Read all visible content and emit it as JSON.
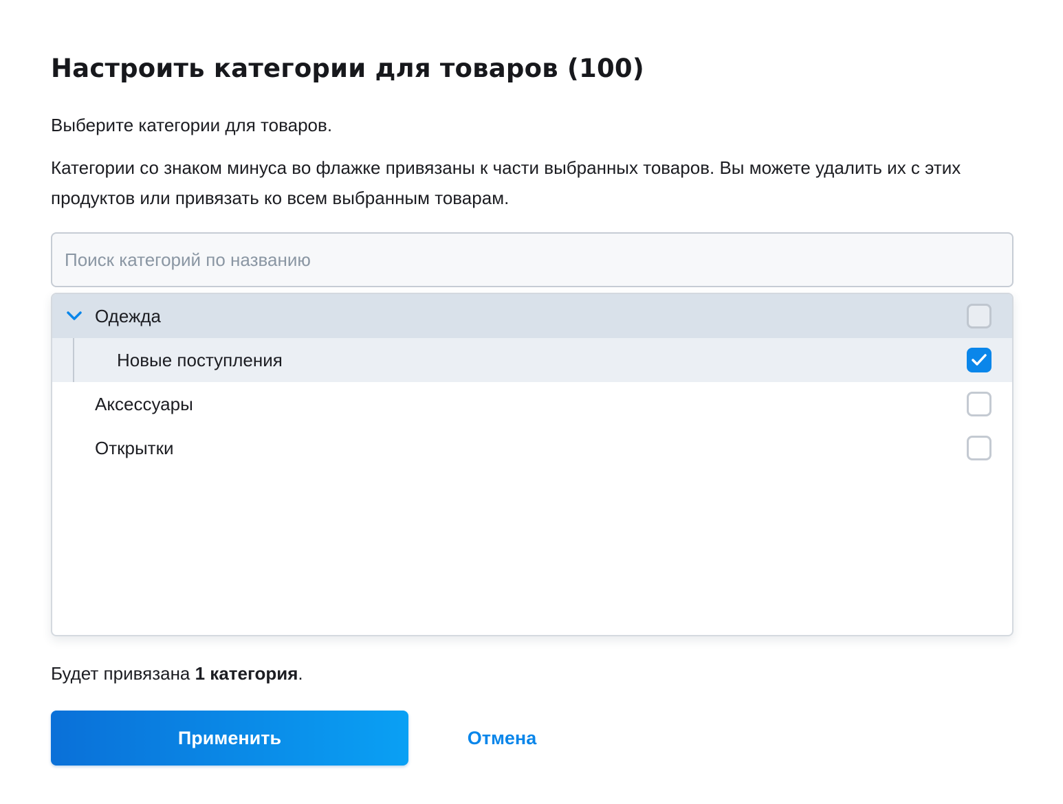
{
  "dialog": {
    "title": "Настроить категории для товаров (100)",
    "description_1": "Выберите категории для товаров.",
    "description_2": "Категории со знаком минуса во флажке привязаны к части выбранных товаров. Вы можете удалить их с этих продуктов или привязать ко всем выбранным товарам."
  },
  "search": {
    "placeholder": "Поиск категорий по названию",
    "value": ""
  },
  "tree": {
    "items": [
      {
        "label": "Одежда",
        "icon": "chevron-down-icon",
        "expanded": true,
        "checked": false
      },
      {
        "label": "Новые поступления",
        "parent": "Одежда",
        "checked": true,
        "icon": "checkmark-icon"
      },
      {
        "label": "Аксессуары",
        "checked": false
      },
      {
        "label": "Открытки",
        "checked": false
      }
    ]
  },
  "summary": {
    "prefix": "Будет привязана ",
    "bold": "1 категория",
    "suffix": "."
  },
  "actions": {
    "apply_label": "Применить",
    "cancel_label": "Отмена"
  },
  "colors": {
    "accent": "#0a86ea",
    "expanded_row_bg": "#d9e1ea",
    "child_row_bg": "#ebeff4"
  }
}
